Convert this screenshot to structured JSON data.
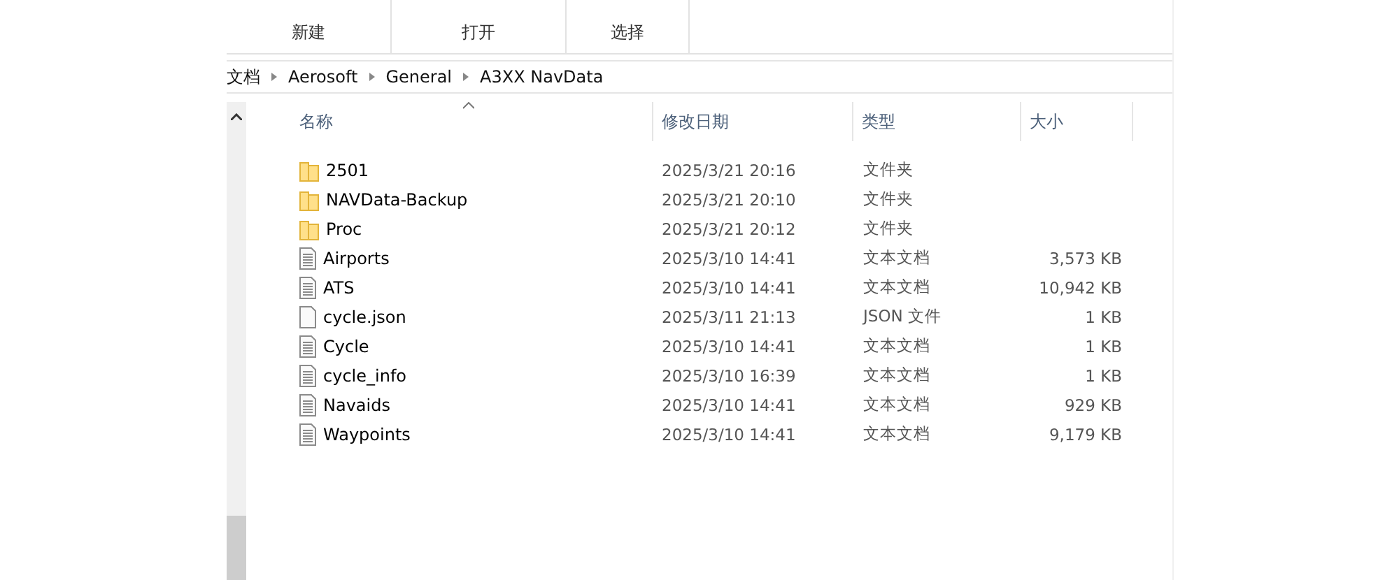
{
  "ribbon": {
    "groups": [
      "新建",
      "打开",
      "选择"
    ]
  },
  "breadcrumb": [
    "文档",
    "Aerosoft",
    "General",
    "A3XX NavData"
  ],
  "table": {
    "columns": [
      "名称",
      "修改日期",
      "类型",
      "大小"
    ],
    "rows": [
      {
        "kind": "folder",
        "name": "2501",
        "modified": "2025/3/21 20:16",
        "type": "文件夹"
      },
      {
        "kind": "folder",
        "name": "NAVData-Backup",
        "modified": "2025/3/21 20:10",
        "type": "文件夹"
      },
      {
        "kind": "folder",
        "name": "Proc",
        "modified": "2025/3/21 20:12",
        "type": "文件夹"
      },
      {
        "kind": "text",
        "name": "Airports",
        "modified": "2025/3/10 14:41",
        "type": "文本文档",
        "size": "3,573 KB"
      },
      {
        "kind": "text",
        "name": "ATS",
        "modified": "2025/3/10 14:41",
        "type": "文本文档",
        "size": "10,942 KB"
      },
      {
        "kind": "file",
        "name": "cycle.json",
        "modified": "2025/3/11 21:13",
        "type": "JSON 文件",
        "size": "1 KB"
      },
      {
        "kind": "text",
        "name": "Cycle",
        "modified": "2025/3/10 14:41",
        "type": "文本文档",
        "size": "1 KB"
      },
      {
        "kind": "text",
        "name": "cycle_info",
        "modified": "2025/3/10 16:39",
        "type": "文本文档",
        "size": "1 KB"
      },
      {
        "kind": "text",
        "name": "Navaids",
        "modified": "2025/3/10 14:41",
        "type": "文本文档",
        "size": "929 KB"
      },
      {
        "kind": "text",
        "name": "Waypoints",
        "modified": "2025/3/10 14:41",
        "type": "文本文档",
        "size": "9,179 KB"
      }
    ]
  }
}
